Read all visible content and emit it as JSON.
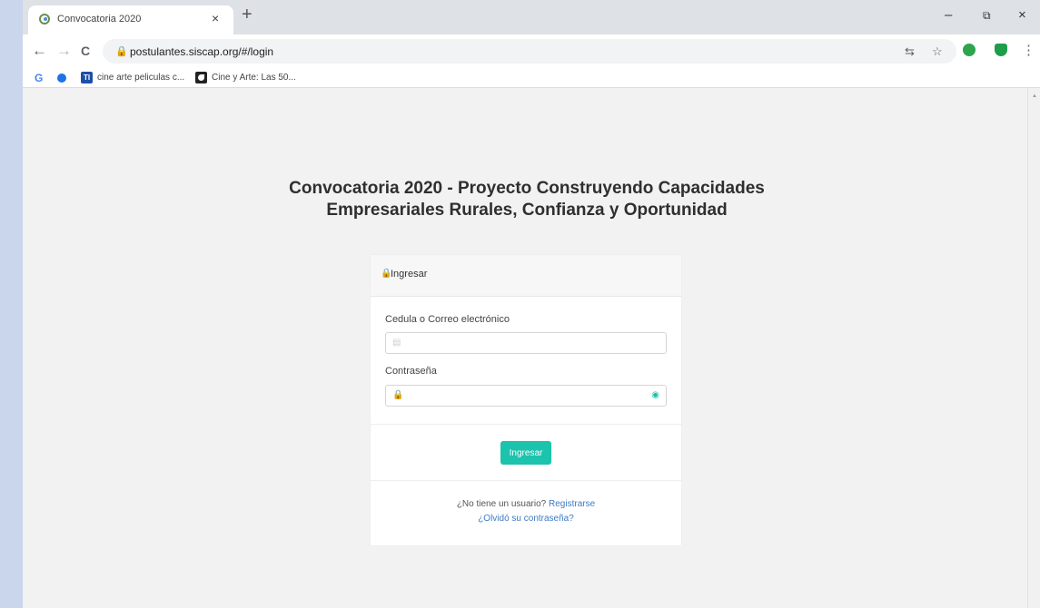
{
  "browser": {
    "tab_title": "Convocatoria 2020",
    "tab_close": "×",
    "new_tab": "+",
    "window_controls": {
      "minimize": "–",
      "restore": "⧉",
      "close": "×"
    },
    "url": "postulantes.siscap.org/#/login",
    "nav": {
      "back": "←",
      "forward": "→",
      "reload": "C"
    },
    "omnibox_icons": {
      "translate": "⇆",
      "star": "☆"
    },
    "extensions": [
      {
        "name": "green-extension-icon",
        "color": "#2ea44f"
      },
      {
        "name": "shield-extension-icon",
        "color": "#1e9e4a"
      }
    ],
    "menu": "⋮",
    "bookmarks": [
      {
        "icon": "G"
      },
      {
        "icon": ""
      },
      {
        "icon": "TI",
        "label": "cine arte peliculas c..."
      },
      {
        "icon": "",
        "label": "Cine y Arte: Las 50..."
      }
    ]
  },
  "page": {
    "title_line1": "Convocatoria 2020 - Proyecto Construyendo Capacidades",
    "title_line2": "Empresariales Rurales, Confianza y Oportunidad"
  },
  "login": {
    "header": "Ingresar",
    "user_label": "Cedula o Correo electrónico",
    "user_value": "",
    "password_label": "Contraseña",
    "password_value": "",
    "submit_label": "Ingresar",
    "no_user_text": "¿No tiene un usuario?",
    "register_link": "Registrarse",
    "forgot_link": "¿Olvidó su contraseña?"
  },
  "colors": {
    "accent": "#1cc3ad",
    "link": "#3d7bc4",
    "page_bg": "#f2f2f2"
  }
}
